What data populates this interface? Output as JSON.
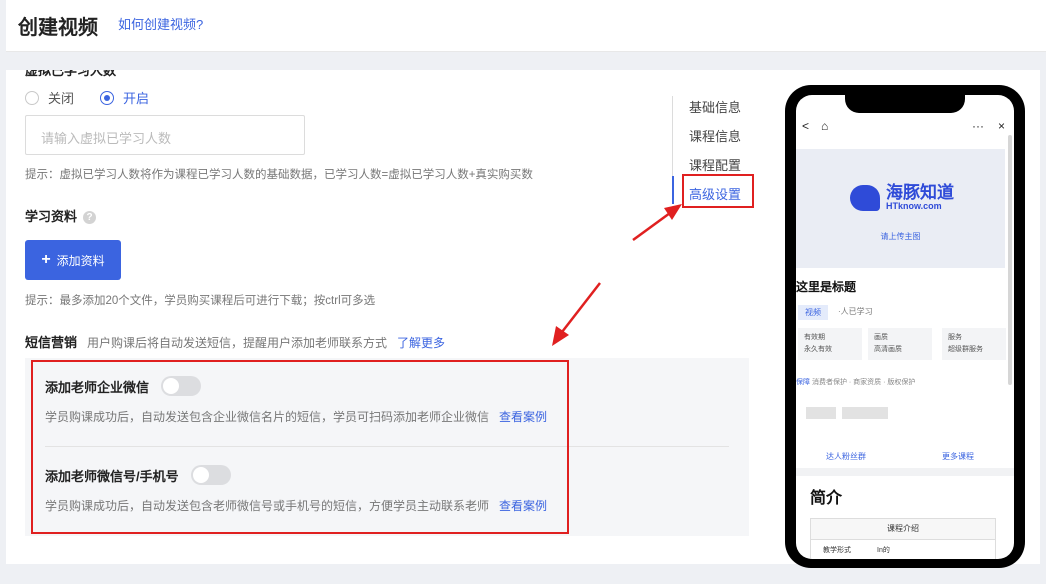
{
  "header": {
    "title": "创建视频",
    "help_link": "如何创建视频?"
  },
  "virtual_learners": {
    "cut_label": "虚拟已学习人数",
    "radio_off": "关闭",
    "radio_on": "开启",
    "selected": "开启",
    "input_placeholder": "请输入虚拟已学习人数",
    "hint": "提示：虚拟已学习人数将作为课程已学习人数的基础数据，已学习人数=虚拟已学习人数+真实购买数"
  },
  "study_materials": {
    "title": "学习资料",
    "add_button": "添加资料",
    "hint": "提示：最多添加20个文件，学员购买课程后可进行下载；按ctrl可多选"
  },
  "sms": {
    "title": "短信营销",
    "desc": "用户购课后将自动发送短信，提醒用户添加老师联系方式",
    "learn_more": "了解更多",
    "items": [
      {
        "title": "添加老师企业微信",
        "desc": "学员购课成功后，自动发送包含企业微信名片的短信，学员可扫码添加老师企业微信",
        "link": "查看案例",
        "enabled": false
      },
      {
        "title": "添加老师微信号/手机号",
        "desc": "学员购课成功后，自动发送包含老师微信号或手机号的短信，方便学员主动联系老师",
        "link": "查看案例",
        "enabled": false
      }
    ]
  },
  "side_nav": {
    "items": [
      "基础信息",
      "课程信息",
      "课程配置",
      "高级设置"
    ],
    "active": "高级设置"
  },
  "colors": {
    "accent": "#3b64e0",
    "highlight": "#e02020"
  },
  "phone_preview": {
    "nav_back": "<",
    "nav_home": "⌂",
    "nav_more": "···",
    "nav_close": "×",
    "logo_text": "海豚知道",
    "logo_sub": "HTknow.com",
    "upload_hint": "请上传主图",
    "title": "这里是标题",
    "tag": "视频",
    "study_count": "·人已学习",
    "features": [
      {
        "name": "有效期",
        "value": "永久有效"
      },
      {
        "name": "画质",
        "value": "高清画质"
      },
      {
        "name": "服务",
        "value": "超级群服务"
      }
    ],
    "guarantee_label": "保障",
    "guarantee_text": "消费者保护 · 商家资质 · 版权保护",
    "btn_fans": "达人粉丝群",
    "btn_more": "更多课程",
    "intro_title": "简介",
    "table_header": "课程介绍",
    "table_col1": "教学形式",
    "table_col2": "In的"
  }
}
